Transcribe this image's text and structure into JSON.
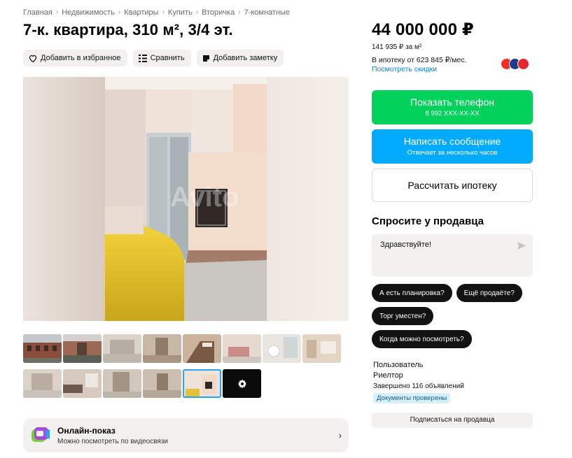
{
  "breadcrumb": [
    "Главная",
    "Недвижимость",
    "Квартиры",
    "Купить",
    "Вторичка",
    "7-комнатные"
  ],
  "breadcrumb_separator": "›",
  "title": "7-к. квартира, 310 м², 3/4 эт.",
  "actions": {
    "favorite": "Добавить в избранное",
    "compare": "Сравнить",
    "note": "Добавить заметку"
  },
  "gallery": {
    "thumbnails_count": 15,
    "active_thumbnail": 14,
    "more_icon": "gear-icon"
  },
  "online_show": {
    "title": "Онлайн-показ",
    "subtitle": "Можно посмотреть по видеосвязи",
    "chevron": "›"
  },
  "price": {
    "main": "44 000 000 ₽",
    "per_meter": "141 935 ₽ за м²",
    "mortgage": "В ипотеку от 623 845 ₽/мес.",
    "discounts_link": "Посмотреть скидки"
  },
  "bank_logos": [
    "alfa-logo-icon",
    "bank-logo-icon",
    "sovcom-logo-icon"
  ],
  "buttons": {
    "show_phone": "Показать телефон",
    "phone_masked": "8 992 XXX-XX-XX",
    "write_message": "Написать сообщение",
    "reply_time": "Отвечает за несколько часов",
    "calc_mortgage": "Рассчитать ипотеку"
  },
  "ask_seller": {
    "title": "Спросите у продавца",
    "message": "Здравствуйте!",
    "chips": [
      "А есть планировка?",
      "Ещё продаёте?",
      "Торг уместен?",
      "Когда можно посмотреть?"
    ]
  },
  "seller": {
    "name": "Пользователь",
    "role": "Риелтор",
    "completed": "Завершено 116 объявлений",
    "badge": "Документы проверены",
    "subscribe": "Подписаться на продавца"
  },
  "colors": {
    "green": "#02d15c",
    "blue": "#00aaff",
    "link": "#0a84d6",
    "chip": "#121212"
  }
}
